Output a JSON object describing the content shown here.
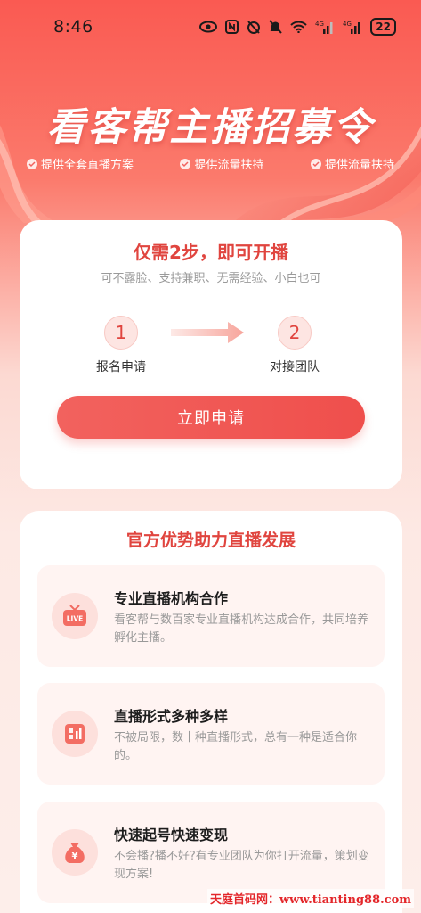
{
  "status_bar": {
    "time": "8:46",
    "battery": "22",
    "network_1": "4G",
    "network_2": "4G"
  },
  "hero": {
    "title": "看客帮主播招募令",
    "features": [
      {
        "label": "提供全套直播方案"
      },
      {
        "label": "提供流量扶持"
      },
      {
        "label": "提供流量扶持"
      }
    ]
  },
  "steps_card": {
    "title": "仅需2步，即可开播",
    "subtitle": "可不露脸、支持兼职、无需经验、小白也可",
    "steps": [
      {
        "number": "1",
        "label": "报名申请"
      },
      {
        "number": "2",
        "label": "对接团队"
      }
    ],
    "apply_button": "立即申请"
  },
  "advantages_card": {
    "title": "官方优势助力直播发展",
    "items": [
      {
        "icon": "live-tv-icon",
        "title": "专业直播机构合作",
        "desc": "看客帮与数百家专业直播机构达成合作，共同培养孵化主播。"
      },
      {
        "icon": "chart-grid-icon",
        "title": "直播形式多种多样",
        "desc": "不被局限，数十种直播形式，总有一种是适合你的。"
      },
      {
        "icon": "money-bag-icon",
        "title": "快速起号快速变现",
        "desc": "不会播?播不好?有专业团队为你打开流量，策划变现方案!"
      }
    ]
  },
  "watermark": "天庭首码网：www.tianting88.com",
  "colors": {
    "accent": "#e0453f",
    "button": "#ef4f4c",
    "hero_bg": "#fa5a52"
  }
}
